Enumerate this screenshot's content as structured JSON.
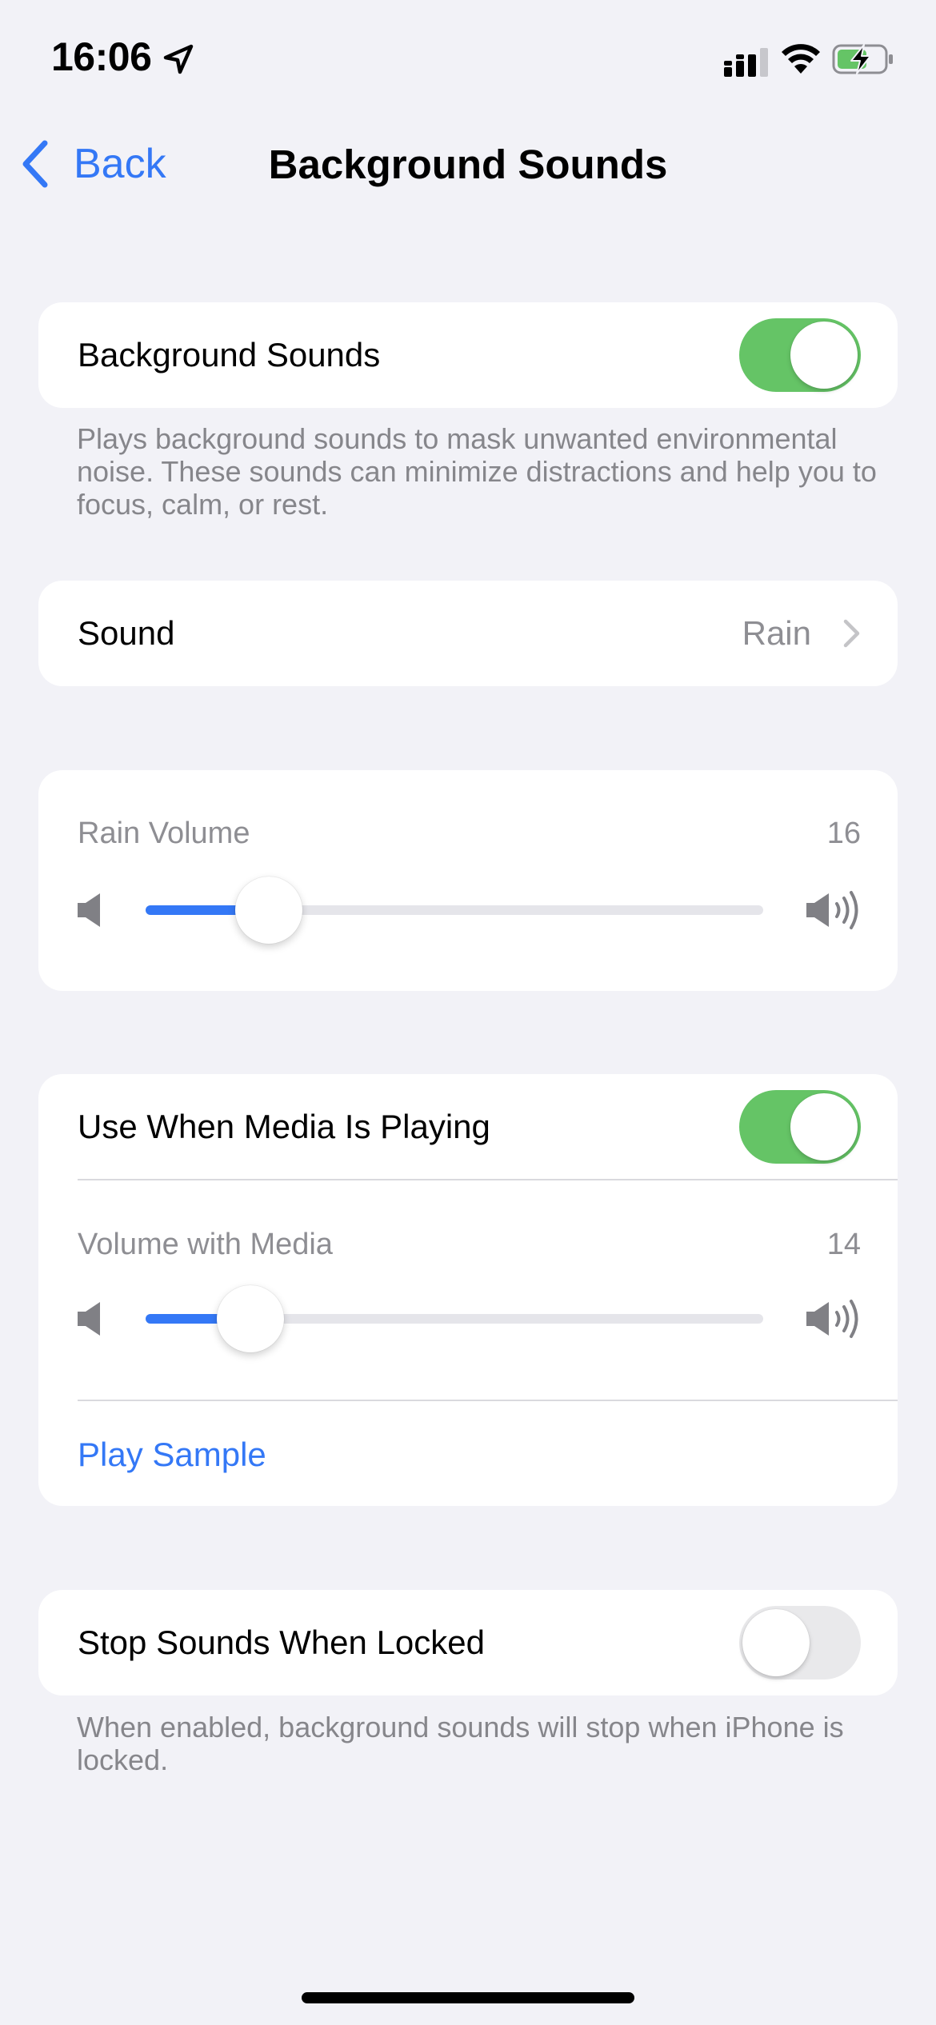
{
  "status_bar": {
    "time": "16:06"
  },
  "nav": {
    "back_label": "Back",
    "title": "Background Sounds"
  },
  "main_toggle": {
    "label": "Background Sounds",
    "on": true,
    "footer": "Plays background sounds to mask unwanted environmental noise. These sounds can minimize distractions and help you to focus, calm, or rest."
  },
  "sound": {
    "label": "Sound",
    "value": "Rain"
  },
  "rain_volume": {
    "caption": "Rain Volume",
    "value": "16",
    "fraction": 0.2
  },
  "media": {
    "toggle_label": "Use When Media Is Playing",
    "toggle_on": true,
    "volume_caption": "Volume with Media",
    "volume_value": "14",
    "volume_fraction": 0.17,
    "play_sample_label": "Play Sample"
  },
  "locked": {
    "label": "Stop Sounds When Locked",
    "on": false,
    "footer": "When enabled, background sounds will stop when iPhone is locked."
  },
  "colors": {
    "accent": "#3478f6",
    "toggle_on": "#65c466",
    "background": "#f2f2f7"
  }
}
